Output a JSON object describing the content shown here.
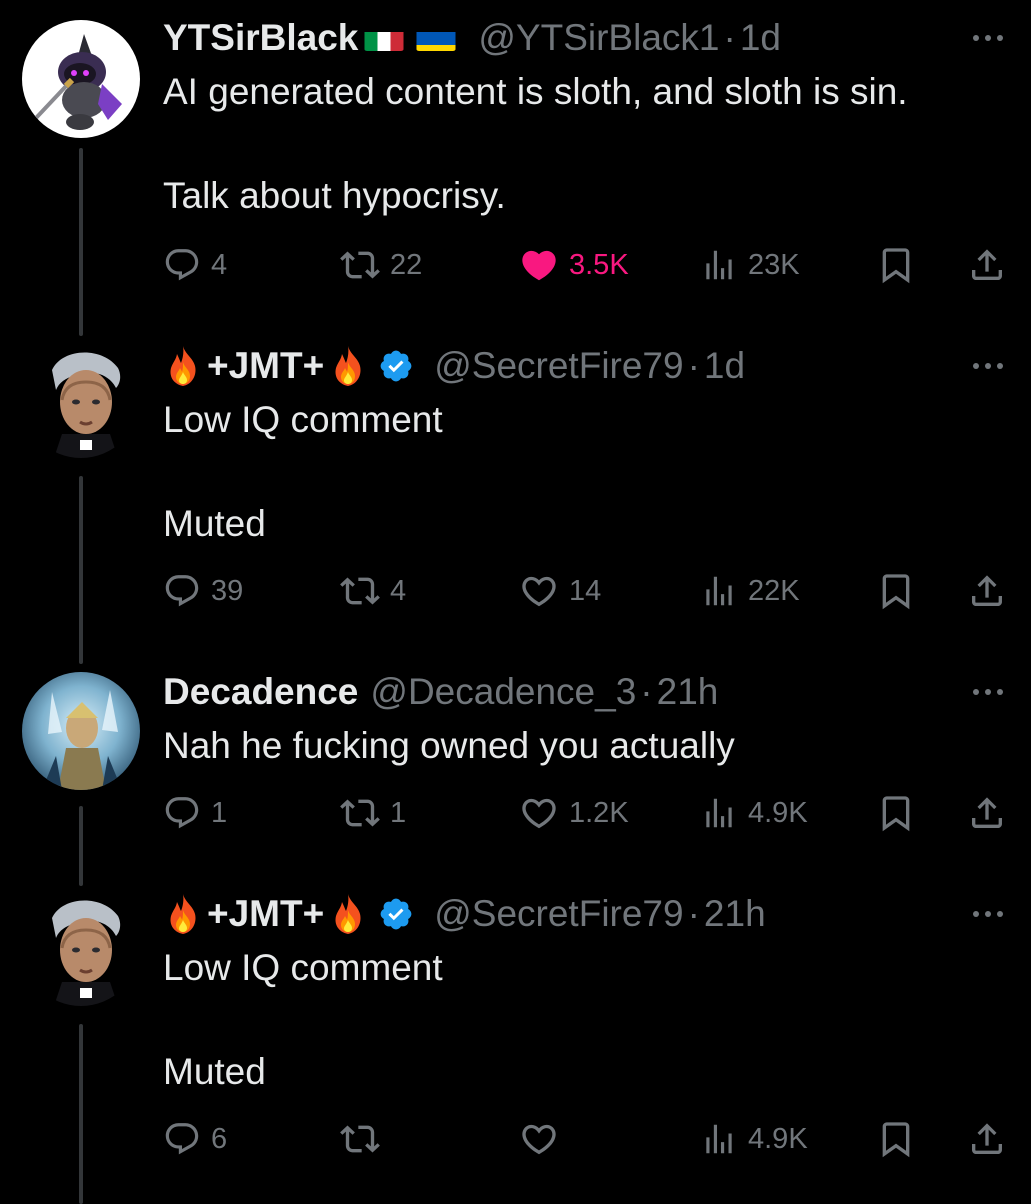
{
  "tweets": [
    {
      "display_name": "YTSirBlack",
      "handle": "@YTSirBlack1",
      "separator": "·",
      "time": "1d",
      "text": "AI generated content is sloth, and sloth is sin.\n\nTalk about hypocrisy.",
      "replies": "4",
      "retweets": "22",
      "likes": "3.5K",
      "liked": true,
      "views": "23K",
      "flags": [
        "italy-flag",
        "ukraine-flag"
      ]
    },
    {
      "display_name_mid": "+JMT+",
      "handle": "@SecretFire79",
      "separator": "·",
      "time": "1d",
      "text": "Low IQ comment\n\nMuted",
      "replies": "39",
      "retweets": "4",
      "likes": "14",
      "liked": false,
      "views": "22K",
      "verified": true
    },
    {
      "display_name": "Decadence",
      "handle": "@Decadence_3",
      "separator": "·",
      "time": "21h",
      "text": "Nah he fucking owned you actually",
      "replies": "1",
      "retweets": "1",
      "likes": "1.2K",
      "liked": false,
      "views": "4.9K"
    },
    {
      "display_name_mid": "+JMT+",
      "handle": "@SecretFire79",
      "separator": "·",
      "time": "21h",
      "text": "Low IQ comment\n\nMuted",
      "replies": "6",
      "retweets": "",
      "likes": "",
      "liked": false,
      "views": "4.9K",
      "verified": true
    }
  ],
  "colors": {
    "background": "#000000",
    "text": "#e7e9ea",
    "secondary": "#71767b",
    "like": "#f91880",
    "verified": "#1d9bf0",
    "thread_line": "#333639"
  },
  "icons": [
    "reply-icon",
    "retweet-icon",
    "like-icon",
    "views-icon",
    "bookmark-icon",
    "share-icon",
    "more-icon",
    "verified-icon",
    "fire-emoji"
  ]
}
